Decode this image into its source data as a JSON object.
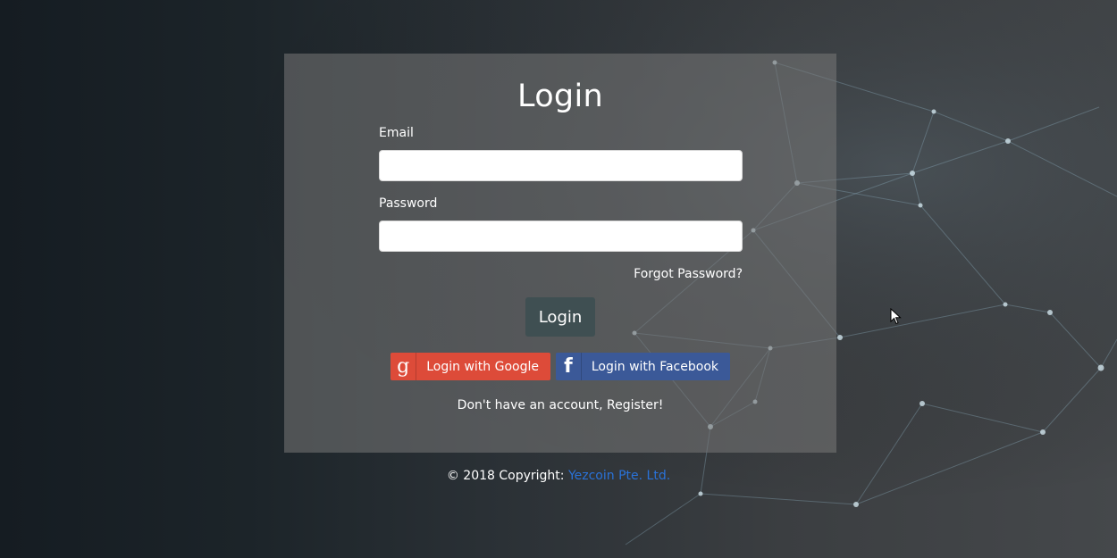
{
  "login": {
    "title": "Login",
    "email_label": "Email",
    "email_value": "",
    "password_label": "Password",
    "password_value": "",
    "forgot_password": "Forgot Password?",
    "submit_label": "Login"
  },
  "social": {
    "google": {
      "label": "Login with Google",
      "icon": "google-g-icon",
      "color": "#dd4b39"
    },
    "facebook": {
      "label": "Login with Facebook",
      "icon": "facebook-f-icon",
      "color": "#3b5998"
    }
  },
  "register_text": "Don't have an account, Register!",
  "footer": {
    "copyright": "© 2018 Copyright: ",
    "company": "Yezcoin Pte. Ltd.",
    "link_color": "#2a72d8"
  }
}
